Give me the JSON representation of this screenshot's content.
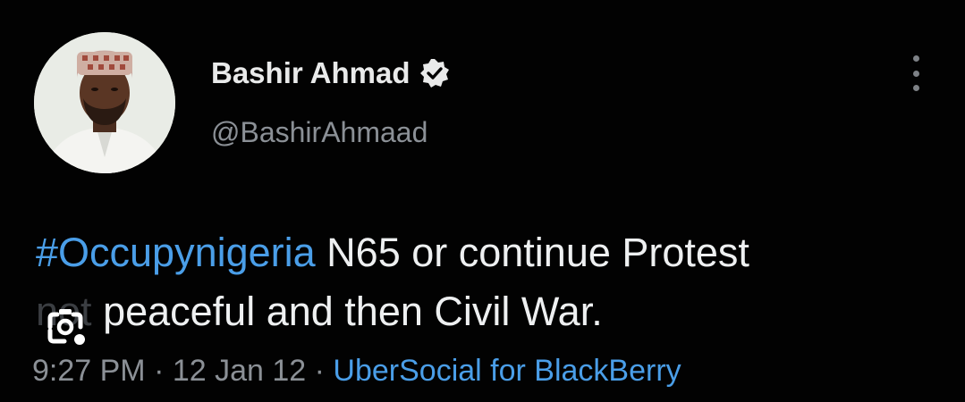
{
  "author": {
    "display_name": "Bashir Ahmad",
    "handle": "@BashirAhmaad",
    "verified_icon": "verified-badge-icon",
    "avatar": "avatar-photo"
  },
  "tweet": {
    "hashtag": "#Occupynigeria",
    "text_line1_rest": " N65 or continue Protest",
    "faded_word": "not",
    "text_line2_rest": " peaceful and then Civil War."
  },
  "meta": {
    "time": "9:27 PM",
    "sep1": " · ",
    "date": "12 Jan 12",
    "sep2": " · ",
    "source": "UberSocial for BlackBerry"
  },
  "icons": {
    "more": "more-vertical-icon",
    "lens": "visual-search-icon"
  },
  "colors": {
    "background": "#020202",
    "link": "#4a9ee8",
    "secondary": "#8b9096",
    "text": "#eef0f1"
  }
}
